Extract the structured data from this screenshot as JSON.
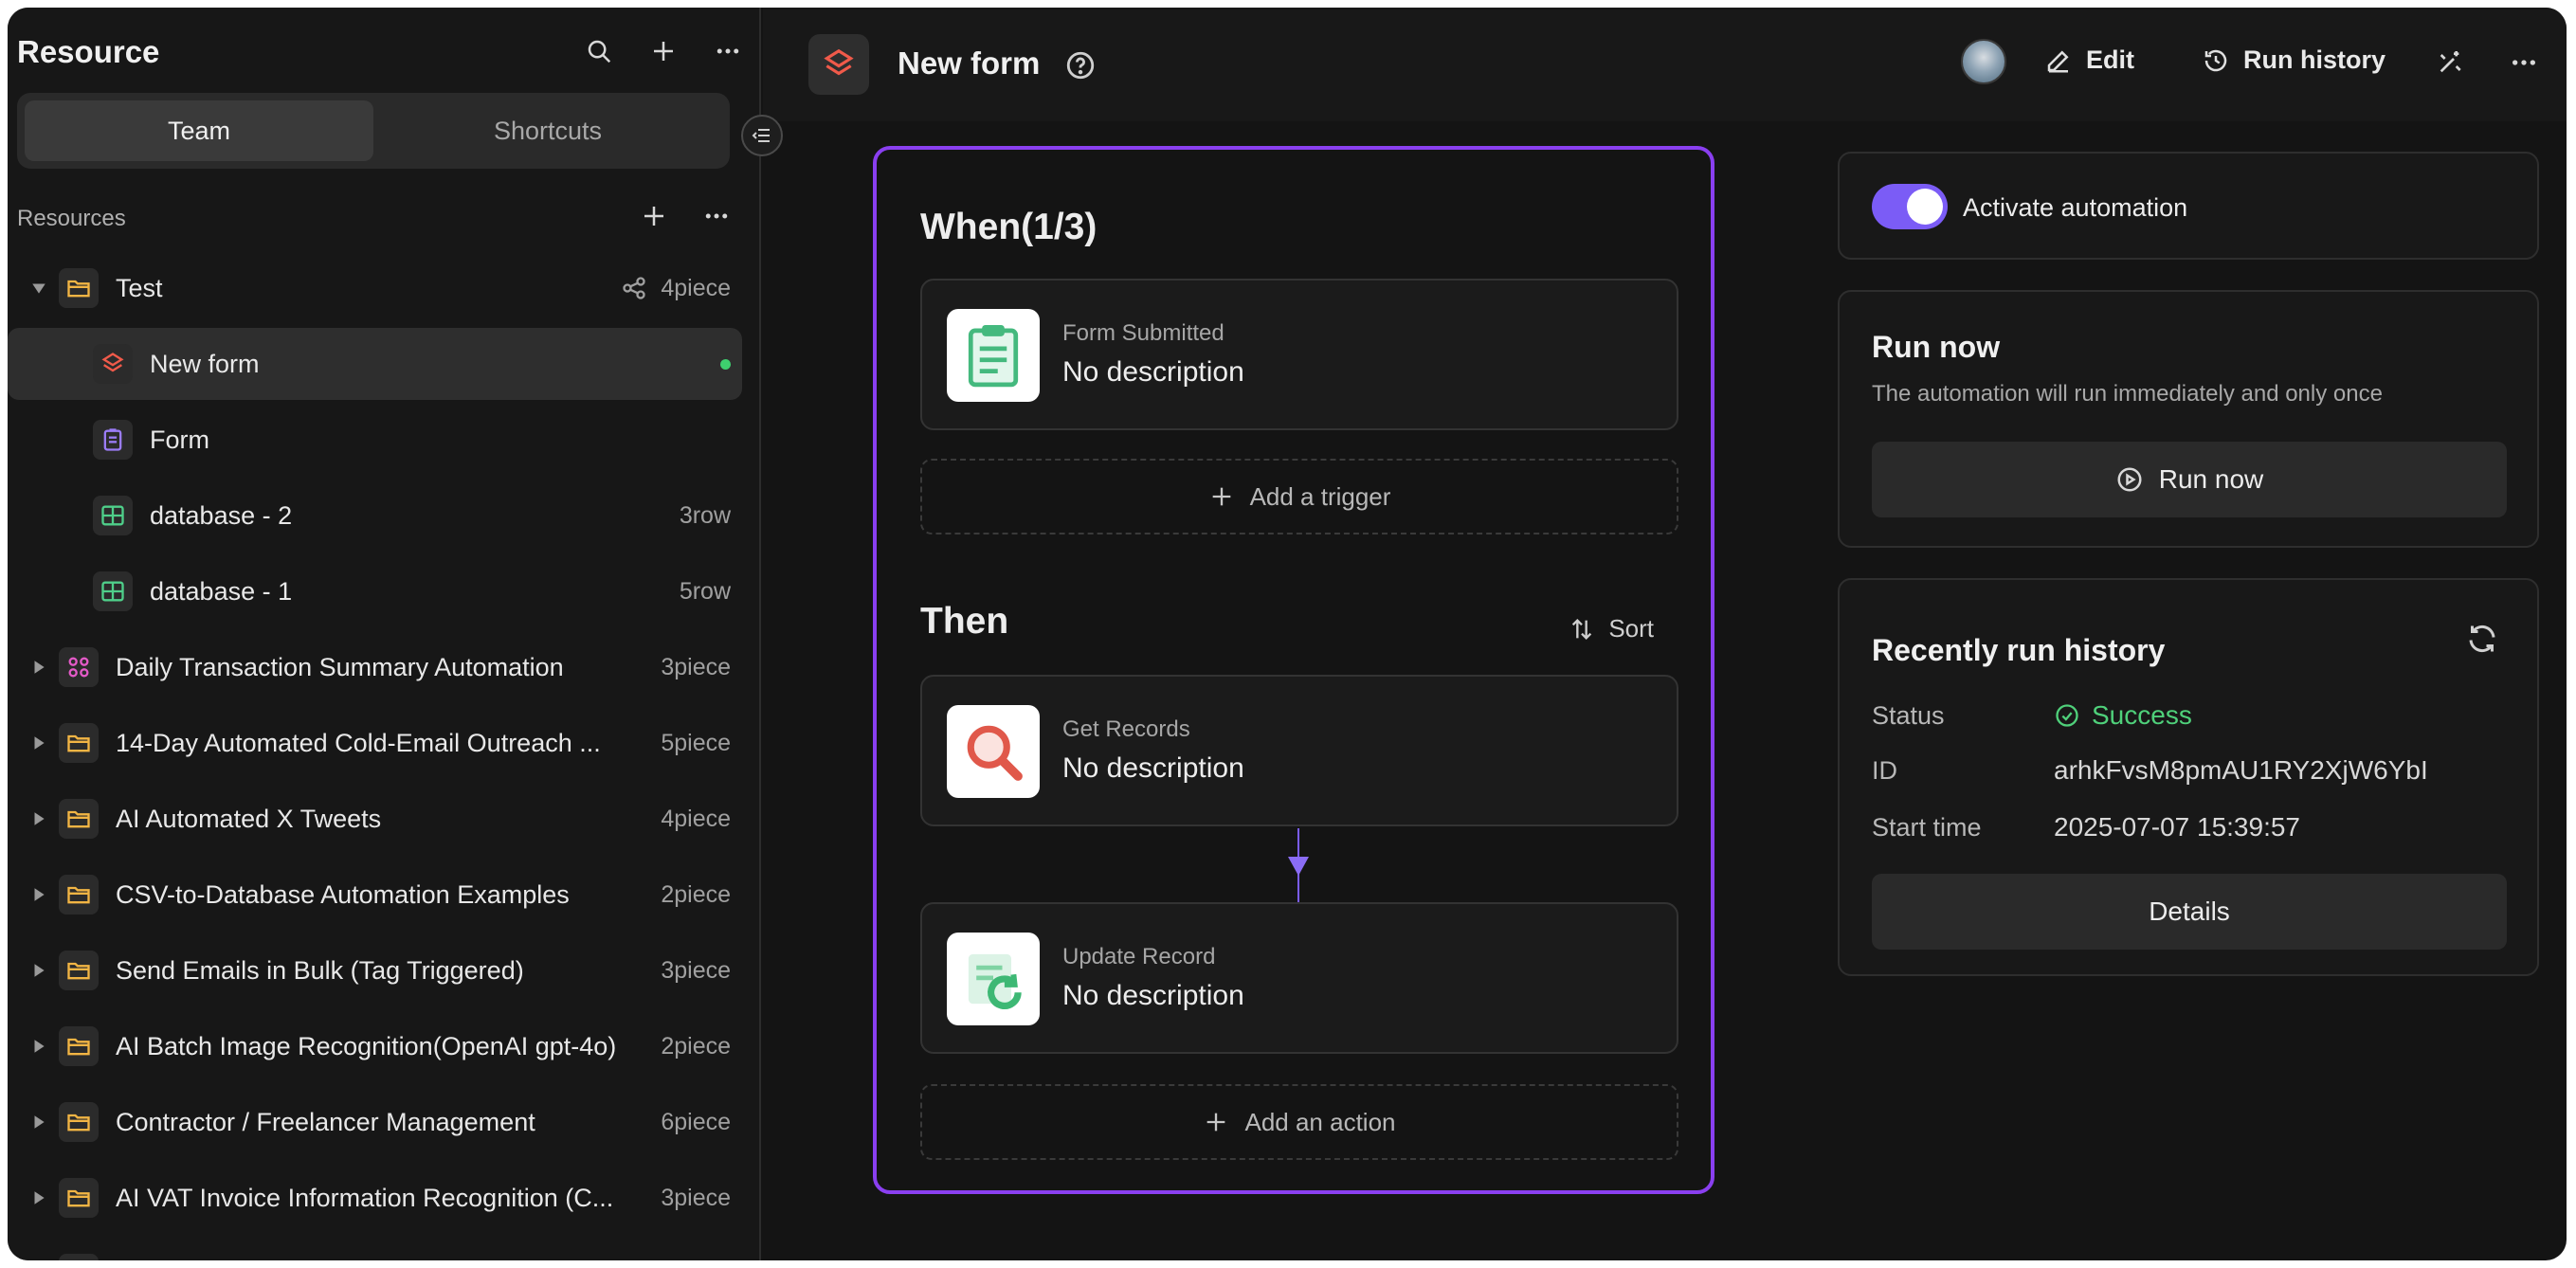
{
  "sidebar": {
    "title": "Resource",
    "tabs": [
      {
        "label": "Team",
        "active": true
      },
      {
        "label": "Shortcuts",
        "active": false
      }
    ],
    "resources_label": "Resources",
    "items": [
      {
        "label": "Test",
        "meta": "4piece",
        "icon": "folder-icon",
        "expanded": true,
        "shared": true
      },
      {
        "label": "New form",
        "meta": "",
        "icon": "automation-icon",
        "child": true,
        "selected": true,
        "status_dot": true
      },
      {
        "label": "Form",
        "meta": "",
        "icon": "form-icon",
        "child": true
      },
      {
        "label": "database - 2",
        "meta": "3row",
        "icon": "table-icon",
        "child": true
      },
      {
        "label": "database - 1",
        "meta": "5row",
        "icon": "table-icon",
        "child": true
      },
      {
        "label": "Daily Transaction Summary Automation",
        "meta": "3piece",
        "icon": "app-grid-icon"
      },
      {
        "label": "14-Day Automated Cold-Email Outreach ...",
        "meta": "5piece",
        "icon": "folder-icon"
      },
      {
        "label": "AI Automated X Tweets",
        "meta": "4piece",
        "icon": "folder-icon"
      },
      {
        "label": "CSV-to-Database Automation Examples",
        "meta": "2piece",
        "icon": "folder-icon"
      },
      {
        "label": "Send Emails in Bulk (Tag Triggered)",
        "meta": "3piece",
        "icon": "folder-icon"
      },
      {
        "label": "AI Batch Image Recognition(OpenAI gpt-4o)",
        "meta": "2piece",
        "icon": "folder-icon"
      },
      {
        "label": "Contractor / Freelancer Management",
        "meta": "6piece",
        "icon": "folder-icon"
      },
      {
        "label": "AI VAT Invoice Information Recognition (C...",
        "meta": "3piece",
        "icon": "folder-icon"
      }
    ]
  },
  "header": {
    "title": "New form",
    "edit_label": "Edit",
    "history_label": "Run history"
  },
  "flow": {
    "when_title": "When(1/3)",
    "trigger": {
      "type": "Form Submitted",
      "description": "No description"
    },
    "add_trigger": "Add a trigger",
    "then_title": "Then",
    "sort_label": "Sort",
    "actions": [
      {
        "type": "Get Records",
        "description": "No description"
      },
      {
        "type": "Update Record",
        "description": "No description"
      }
    ],
    "add_action": "Add an action"
  },
  "panels": {
    "activate_label": "Activate automation",
    "activate_on": true,
    "run_now": {
      "title": "Run now",
      "subtitle": "The automation will run immediately and only once",
      "button": "Run now"
    },
    "history": {
      "title": "Recently run history",
      "status_key": "Status",
      "status_value": "Success",
      "id_key": "ID",
      "id_value": "arhkFvsM8pmAU1RY2XjW6YbI",
      "start_key": "Start time",
      "start_value": "2025-07-07 15:39:57",
      "details_button": "Details"
    }
  },
  "colors": {
    "accent": "#8a3ff0",
    "toggle": "#7b5cf6",
    "success": "#4fd07a",
    "folder": "#f2b544",
    "status_dot": "#3ecf6e"
  }
}
